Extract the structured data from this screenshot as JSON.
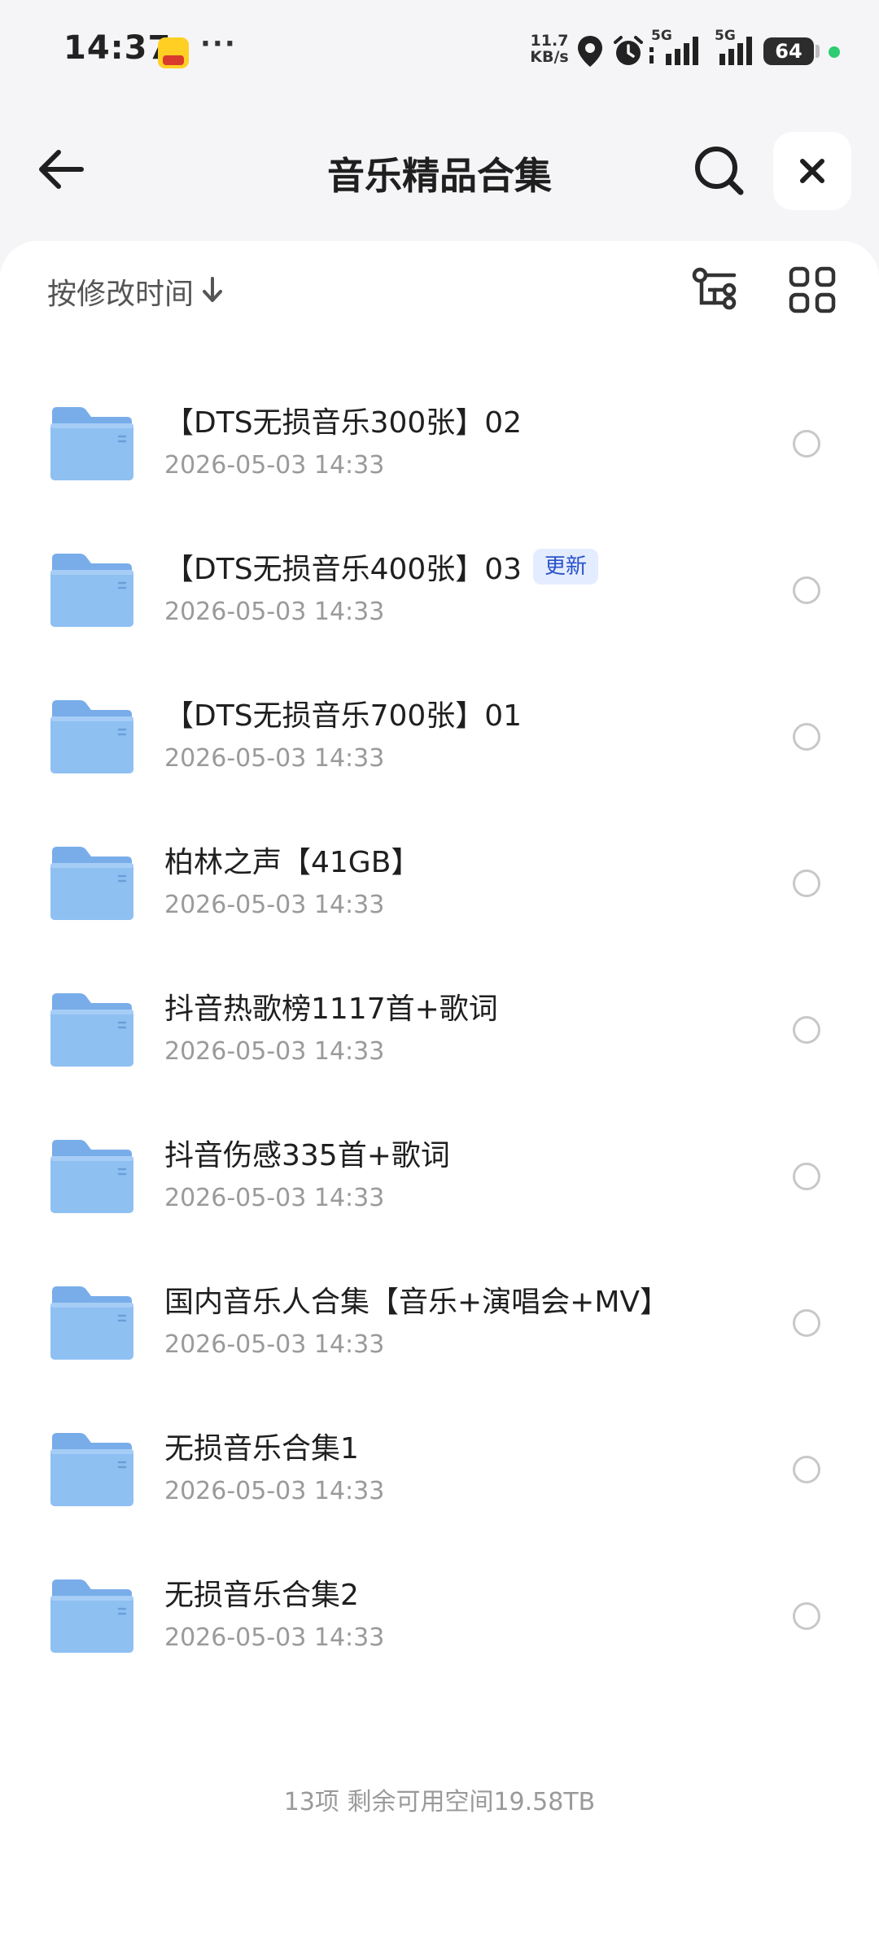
{
  "status_bar": {
    "time": "14:37",
    "more": "···",
    "net_speed_value": "11.7",
    "net_speed_unit": "KB/s",
    "signal1_label": "5G",
    "signal2_label": "5G",
    "battery": "64"
  },
  "header": {
    "title": "音乐精品合集"
  },
  "sort": {
    "label": "按修改时间"
  },
  "files": [
    {
      "name": "",
      "date": "2026-05-03 14:33",
      "badge": ""
    },
    {
      "name": "【DTS无损音乐300张】02",
      "date": "2026-05-03 14:33",
      "badge": ""
    },
    {
      "name": "【DTS无损音乐400张】03",
      "date": "2026-05-03 14:33",
      "badge": "更新"
    },
    {
      "name": "【DTS无损音乐700张】01",
      "date": "2026-05-03 14:33",
      "badge": ""
    },
    {
      "name": "柏林之声【41GB】",
      "date": "2026-05-03 14:33",
      "badge": ""
    },
    {
      "name": "抖音热歌榜1117首+歌词",
      "date": "2026-05-03 14:33",
      "badge": ""
    },
    {
      "name": "抖音伤感335首+歌词",
      "date": "2026-05-03 14:33",
      "badge": ""
    },
    {
      "name": "国内音乐人合集【音乐+演唱会+MV】",
      "date": "2026-05-03 14:33",
      "badge": ""
    },
    {
      "name": "无损音乐合集1",
      "date": "2026-05-03 14:33",
      "badge": ""
    },
    {
      "name": "无损音乐合集2",
      "date": "2026-05-03 14:33",
      "badge": ""
    }
  ],
  "footer": {
    "summary": "13项 剩余可用空间19.58TB"
  },
  "icons": {
    "back": "arrow-left-icon",
    "search": "search-icon",
    "close": "close-icon",
    "sort_arrow": "arrow-down-icon",
    "tree_view": "tree-view-icon",
    "grid_view": "grid-view-icon",
    "folder": "folder-icon"
  },
  "colors": {
    "folder_blue": "#7fb3ee",
    "badge_bg": "#e4ecff",
    "badge_text": "#2a52c9",
    "privacy_dot": "#2ecc71"
  }
}
